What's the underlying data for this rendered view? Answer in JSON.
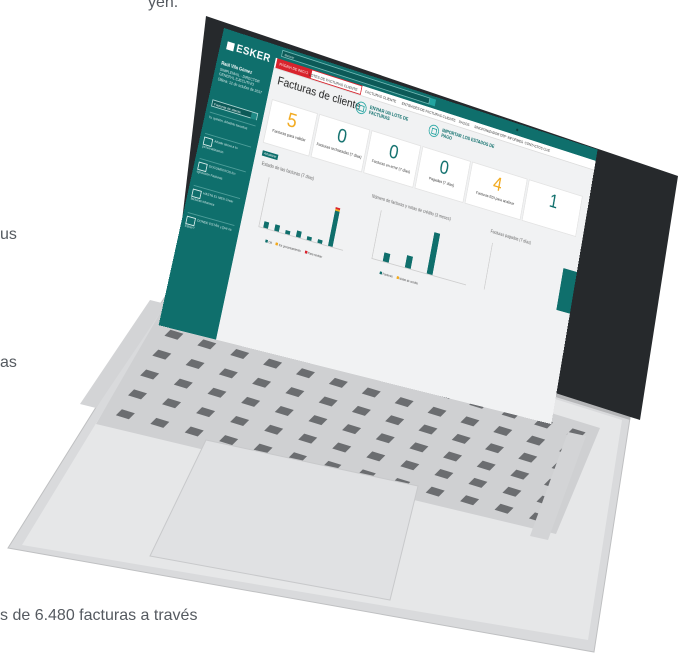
{
  "page_text": {
    "top": "yen.",
    "left1": "us",
    "left2": "as",
    "bottom": "s de 6.480 facturas a través"
  },
  "app": {
    "logo": "ESKER",
    "user_name": "Raúl Vila Gómez",
    "user_lines": [
      "SIMPLEMAIL - DIRECTOR",
      "GENERAL EJECUTIVO",
      "Última: 12 de octubre de 2017"
    ],
    "selector": "Facturas de cliente",
    "sidebar_sections": [
      {
        "label": "Tu opinión, Añadirlo favoritos"
      },
      {
        "label": "Añade ahora a tu personalización"
      },
      {
        "label": "DOCUMENTOS En ejecución Facturas"
      },
      {
        "label": "HASTA EL MES Crear facturas informes"
      },
      {
        "label": "DONDE ESTÁS ¿Qué es Esker?"
      }
    ],
    "search_placeholder": "Buscar",
    "tabs": [
      "PÁGINA DE INICIO",
      "LOTES DE FACTURAS CLIENTE",
      "FACTURAS CLIENTE",
      "ENTIDADES DE FACTURAS CLIENTE",
      "PAGOS",
      "SINCRONIZADOR ERP",
      "INFORMES",
      "CONTACTOS CLIE"
    ],
    "page_title": "Facturas de cliente",
    "actions": [
      "ENVIAR UN LOTE DE FACTURAS",
      "IMPORTAR LOS ESTADOS DE PAGO"
    ],
    "tiles": [
      {
        "value": "5",
        "label": "Facturas para validar"
      },
      {
        "value": "0",
        "label": "Facturas rechazadas (7 días)"
      },
      {
        "value": "0",
        "label": "Facturas en error (7 días)"
      },
      {
        "value": "0",
        "label": "Pagadas (7 días)"
      },
      {
        "value": "4",
        "label": "Facturas EDI para analizar"
      },
      {
        "value": "1",
        "label": ""
      }
    ],
    "badge": "Actualizar",
    "chart_titles": [
      "Estado de las facturas (7 días)",
      "Número de facturas y notas de crédito (3 meses)",
      "Facturas pagadas (7 días)"
    ],
    "legend1": [
      "Ok",
      "En procesamiento",
      "Para revisar"
    ],
    "legend2": [
      "Facturas",
      "Notas de crédito"
    ]
  },
  "chart_data": [
    {
      "type": "bar",
      "title": "Estado de las facturas (7 días)",
      "values": [
        2,
        2,
        1,
        2,
        1,
        1,
        12
      ]
    },
    {
      "type": "bar",
      "title": "Número de facturas y notas de crédito (3 meses)",
      "values": [
        2,
        3,
        10
      ]
    }
  ]
}
